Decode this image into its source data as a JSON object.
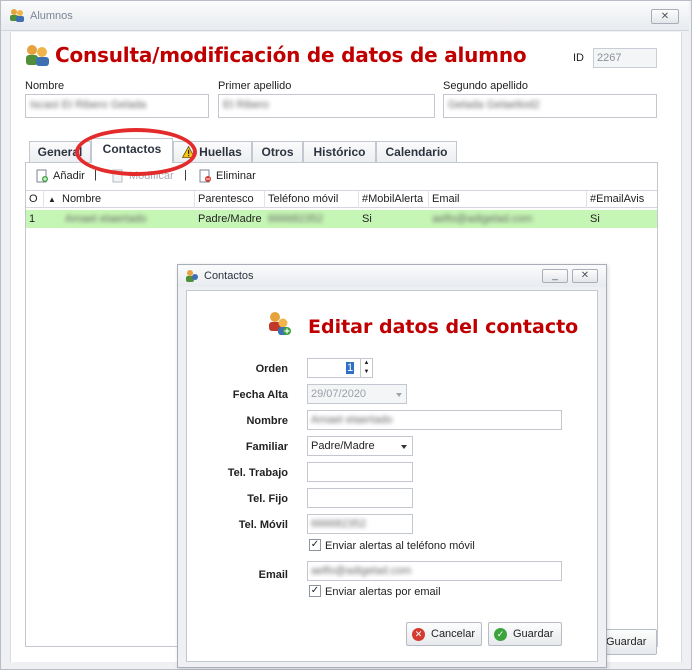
{
  "window": {
    "title": "Alumnos",
    "close_glyph": "✕"
  },
  "header": {
    "title": "Consulta/modificación de datos de alumno",
    "id_label": "ID",
    "id_value": "2267"
  },
  "student": {
    "nombre_label": "Nombre",
    "nombre_value": "Iscaoi Et Ribero Gelada",
    "apellido1_label": "Primer apellido",
    "apellido1_value": "Et Ribero",
    "apellido2_label": "Segundo apellido",
    "apellido2_value": "Gelada Gelaeltod2"
  },
  "tabs": [
    {
      "label": "General"
    },
    {
      "label": "Contactos"
    },
    {
      "label": "Huellas"
    },
    {
      "label": "Otros"
    },
    {
      "label": "Histórico"
    },
    {
      "label": "Calendario"
    }
  ],
  "toolbar": {
    "add_label": "Añadir",
    "edit_label": "Modificar",
    "delete_label": "Eliminar"
  },
  "grid": {
    "columns": [
      "O",
      "Nombre",
      "Parentesco",
      "Teléfono móvil",
      "#MobilAlerta",
      "Email",
      "#EmailAvis"
    ],
    "rows": [
      {
        "orden": "1",
        "nombre": "Amaet etaertado",
        "parentesco": "Padre/Madre",
        "telefono": "666682352",
        "mobil_alerta": "Si",
        "email": "aelfo@adigelad.com",
        "email_avis": "Si"
      }
    ]
  },
  "footer": {
    "save_label": "Guardar"
  },
  "dialog": {
    "title": "Contactos",
    "heading": "Editar datos del contacto",
    "orden_label": "Orden",
    "orden_value": "1",
    "fecha_alta_label": "Fecha Alta",
    "fecha_alta_value": "29/07/2020",
    "nombre_label": "Nombre",
    "nombre_value": "Amaet etaertado",
    "familiar_label": "Familiar",
    "familiar_value": "Padre/Madre",
    "tel_trabajo_label": "Tel. Trabajo",
    "tel_trabajo_value": "",
    "tel_fijo_label": "Tel. Fijo",
    "tel_fijo_value": "",
    "tel_movil_label": "Tel. Móvil",
    "tel_movil_value": "666682352",
    "alert_movil_label": "Enviar alertas al teléfono móvil",
    "alert_movil_checked": true,
    "email_label": "Email",
    "email_value": "aelfo@adigelad.com",
    "alert_email_label": "Enviar alertas por email",
    "alert_email_checked": true,
    "cancel_label": "Cancelar",
    "save_label": "Guardar",
    "check_glyph": "✓"
  },
  "colors": {
    "heading_red": "#c00000",
    "selected_row": "#c6f6b5",
    "annotation_circle": "#e32b2b"
  }
}
